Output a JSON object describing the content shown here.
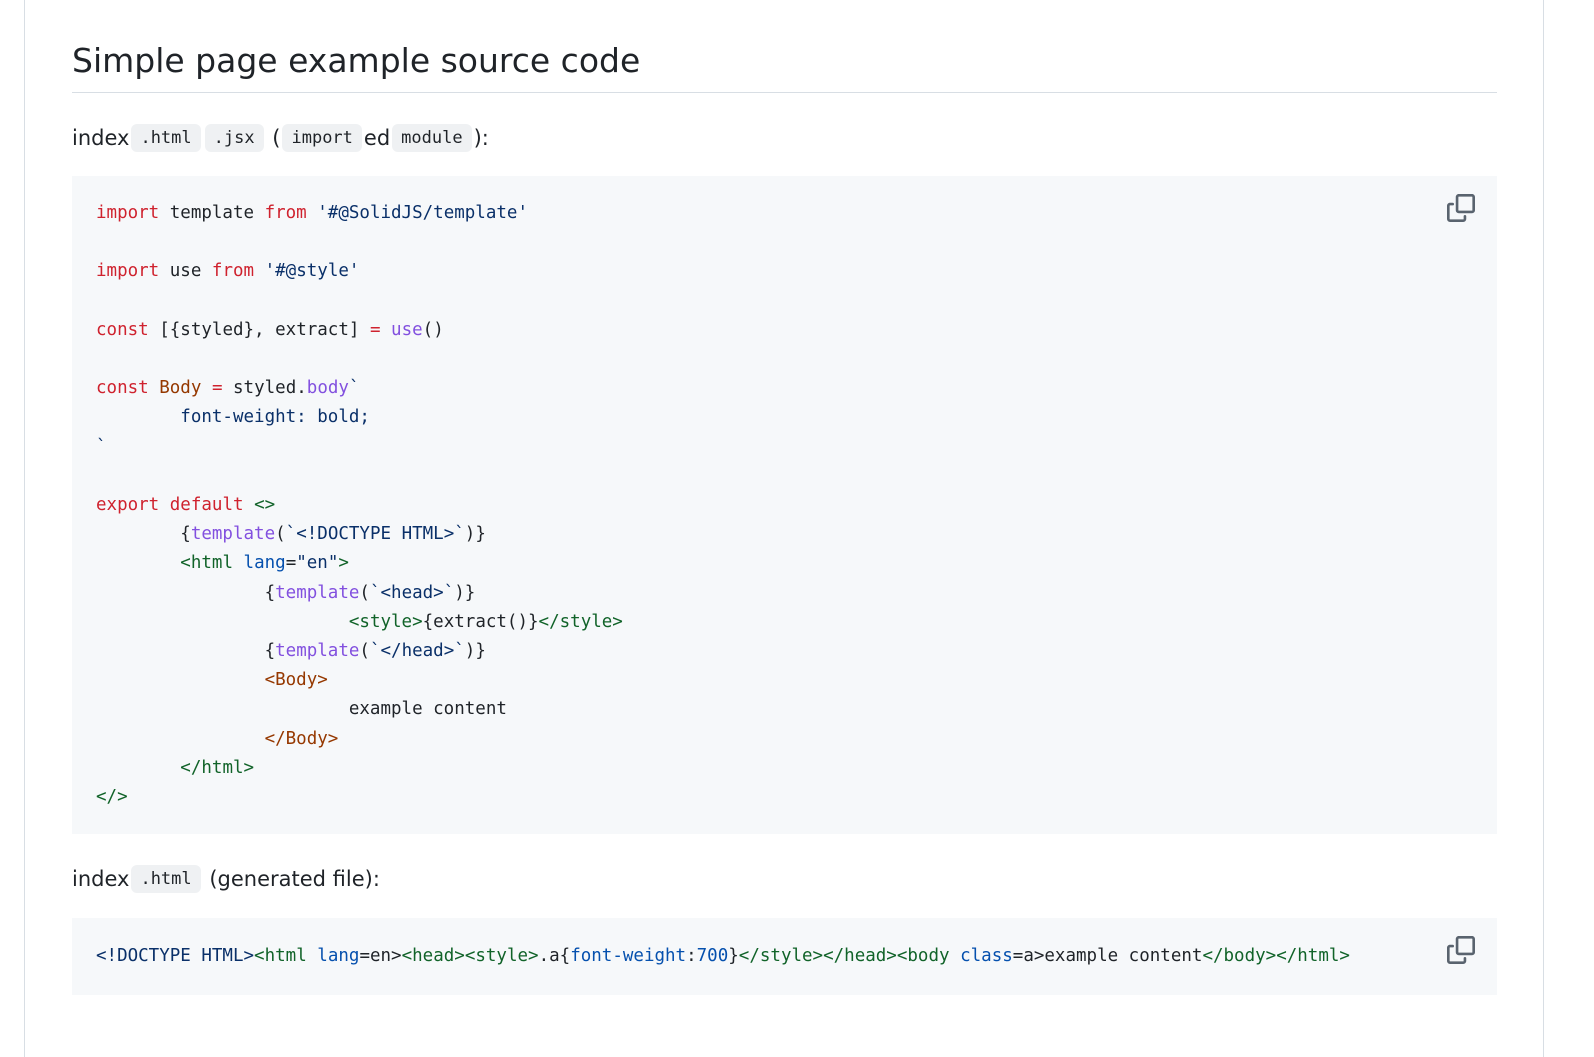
{
  "section": {
    "title": "Simple page example source code"
  },
  "para1": {
    "text_index": "index",
    "code_html": ".html",
    "code_jsx": ".jsx",
    "text_paren_open": "(",
    "code_import": "import",
    "text_ed": "ed",
    "code_module": "module",
    "text_close": "):"
  },
  "code1": {
    "lines": [
      [
        [
          "k",
          "import"
        ],
        [
          "p",
          " template "
        ],
        [
          "k",
          "from"
        ],
        [
          "s",
          " '#@SolidJS/template'"
        ]
      ],
      [],
      [
        [
          "k",
          "import"
        ],
        [
          "p",
          " use "
        ],
        [
          "k",
          "from"
        ],
        [
          "s",
          " '#@style'"
        ]
      ],
      [],
      [
        [
          "k",
          "const"
        ],
        [
          "p",
          " [{styled}, extract] "
        ],
        [
          "k",
          "="
        ],
        [
          "p",
          " "
        ],
        [
          "f",
          "use"
        ],
        [
          "p",
          "()"
        ]
      ],
      [],
      [
        [
          "k",
          "const"
        ],
        [
          "p",
          " "
        ],
        [
          "c",
          "Body"
        ],
        [
          "p",
          " "
        ],
        [
          "k",
          "="
        ],
        [
          "p",
          " styled."
        ],
        [
          "f",
          "body"
        ],
        [
          "s",
          "`"
        ]
      ],
      [
        [
          "s",
          "        font-weight: bold;"
        ]
      ],
      [
        [
          "s",
          "`"
        ]
      ],
      [],
      [
        [
          "k",
          "export"
        ],
        [
          "p",
          " "
        ],
        [
          "k",
          "default"
        ],
        [
          "p",
          " "
        ],
        [
          "t",
          "<>"
        ]
      ],
      [
        [
          "p",
          "        {"
        ],
        [
          "f",
          "template"
        ],
        [
          "p",
          "("
        ],
        [
          "s",
          "`<!DOCTYPE HTML>`"
        ],
        [
          "p",
          ")}"
        ]
      ],
      [
        [
          "p",
          "        "
        ],
        [
          "t",
          "<html"
        ],
        [
          "p",
          " "
        ],
        [
          "a",
          "lang"
        ],
        [
          "p",
          "="
        ],
        [
          "s",
          "\"en\""
        ],
        [
          "t",
          ">"
        ]
      ],
      [
        [
          "p",
          "                {"
        ],
        [
          "f",
          "template"
        ],
        [
          "p",
          "("
        ],
        [
          "s",
          "`<head>`"
        ],
        [
          "p",
          ")}"
        ]
      ],
      [
        [
          "p",
          "                        "
        ],
        [
          "t",
          "<style>"
        ],
        [
          "p",
          "{extract()}"
        ],
        [
          "t",
          "</style>"
        ]
      ],
      [
        [
          "p",
          "                {"
        ],
        [
          "f",
          "template"
        ],
        [
          "p",
          "("
        ],
        [
          "s",
          "`</head>`"
        ],
        [
          "p",
          ")}"
        ]
      ],
      [
        [
          "p",
          "                "
        ],
        [
          "c",
          "<Body>"
        ]
      ],
      [
        [
          "p",
          "                        example content"
        ]
      ],
      [
        [
          "p",
          "                "
        ],
        [
          "c",
          "</Body>"
        ]
      ],
      [
        [
          "p",
          "        "
        ],
        [
          "t",
          "</html>"
        ]
      ],
      [
        [
          "t",
          "</>"
        ]
      ]
    ]
  },
  "para2": {
    "text_index": "index",
    "code_html": ".html",
    "text_generated": "(generated file):"
  },
  "code2": {
    "lines": [
      [
        [
          "s",
          "<!DOCTYPE HTML>"
        ],
        [
          "t",
          "<html"
        ],
        [
          "p",
          " "
        ],
        [
          "a",
          "lang"
        ],
        [
          "p",
          "=en>"
        ],
        [
          "t",
          "<head>"
        ],
        [
          "t",
          "<style>"
        ],
        [
          "p",
          ".a{"
        ],
        [
          "a",
          "font-weight"
        ],
        [
          "p",
          ":"
        ],
        [
          "a",
          "700"
        ],
        [
          "p",
          "}"
        ],
        [
          "t",
          "</style>"
        ],
        [
          "t",
          "</head>"
        ],
        [
          "t",
          "<body"
        ],
        [
          "p",
          " "
        ],
        [
          "a",
          "class"
        ],
        [
          "p",
          "=a>example content"
        ],
        [
          "t",
          "</body>"
        ],
        [
          "t",
          "</html>"
        ]
      ]
    ]
  },
  "icons": {
    "copy": "copy-icon"
  },
  "colors": {
    "keyword": "#cf222e",
    "string": "#0a3069",
    "function": "#8250df",
    "component": "#953800",
    "tag": "#116329",
    "attribute": "#0550ae",
    "code_bg": "#f6f8fa",
    "inline_code_bg": "#eff1f3"
  }
}
